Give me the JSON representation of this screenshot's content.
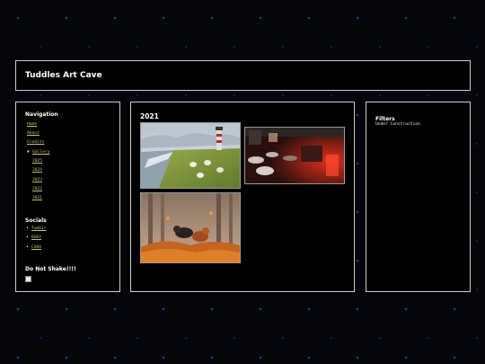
{
  "site": {
    "title": "Tuddles Art Cave"
  },
  "nav": {
    "heading": "Navigation",
    "links": [
      "Home",
      "About",
      "Credits"
    ],
    "gallery": {
      "toggle": "▼",
      "label": "Gallery",
      "years": [
        "2025",
        "2024",
        "2023",
        "2022",
        "2021"
      ]
    }
  },
  "socials": {
    "heading": "Socials",
    "links": [
      "Tumblr",
      "BSKY",
      "CARA"
    ]
  },
  "shake": {
    "heading": "Do Not Shake!!!!"
  },
  "main": {
    "heading": "2021"
  },
  "filters": {
    "heading": "Filters",
    "status": "Under Construction"
  }
}
